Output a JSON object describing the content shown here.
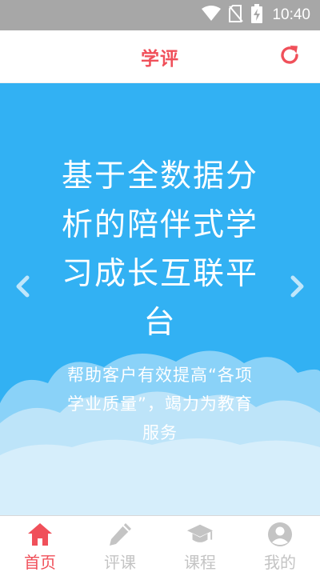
{
  "status_bar": {
    "time": "10:40",
    "icons": [
      "wifi-icon",
      "no-sim-icon",
      "battery-charging-icon"
    ]
  },
  "header": {
    "title": "学评",
    "refresh_icon": "refresh-icon"
  },
  "hero": {
    "title": "基于全数据分析的陪伴式学习成长互联平台",
    "subtitle": "帮助客户有效提高“各项学业质量”，竭力为教育服务",
    "prev_icon": "chevron-left-icon",
    "next_icon": "chevron-right-icon"
  },
  "bottom_nav": {
    "items": [
      {
        "label": "首页",
        "icon": "home-icon",
        "active": true
      },
      {
        "label": "评课",
        "icon": "pencil-icon",
        "active": false
      },
      {
        "label": "课程",
        "icon": "graduation-cap-icon",
        "active": false
      },
      {
        "label": "我的",
        "icon": "user-icon",
        "active": false
      }
    ]
  },
  "colors": {
    "brand": "#f0505a",
    "hero_bg": "#32b1f3",
    "inactive": "#c4c4c4",
    "status_bar": "#a7a7a7"
  }
}
